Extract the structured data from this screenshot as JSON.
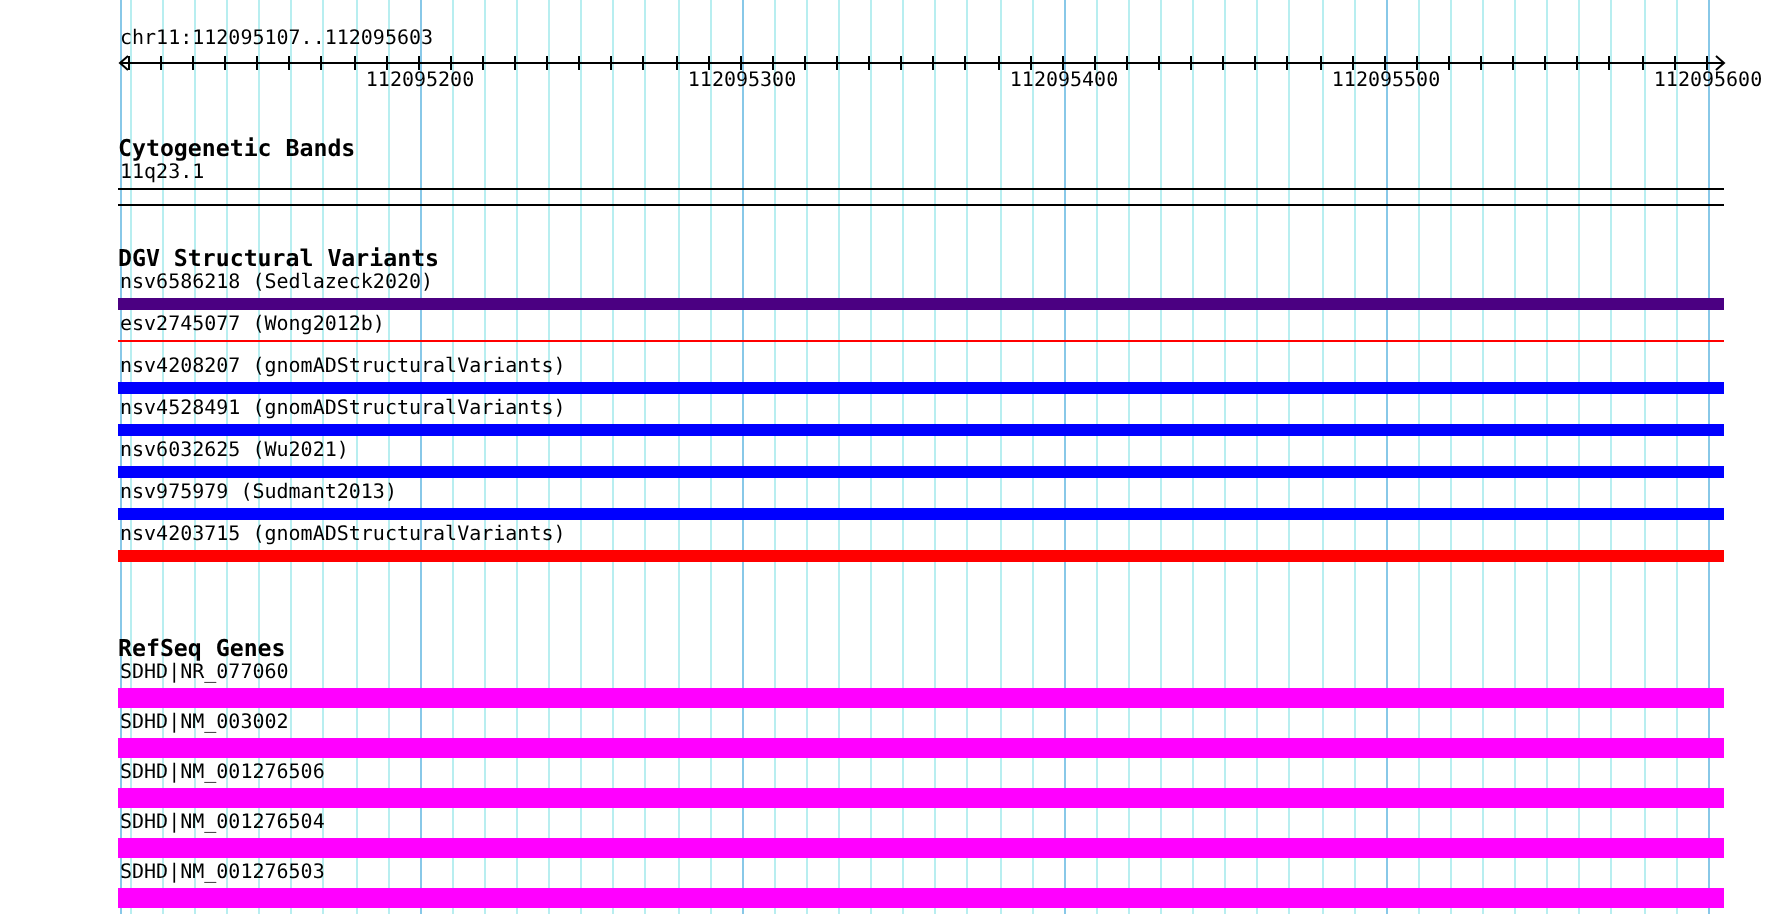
{
  "ruler": {
    "location": "chr11:112095107..112095603",
    "tick_labels": [
      "112095200",
      "112095300",
      "112095400",
      "112095500",
      "112095600"
    ]
  },
  "tracks": [
    {
      "title": "Cytogenetic Bands",
      "items": [
        {
          "label": "11q23.1",
          "kind": "line",
          "color": "#000000"
        }
      ]
    },
    {
      "title": "DGV Structural Variants",
      "items": [
        {
          "label": "nsv6586218 (Sedlazeck2020)",
          "kind": "bar",
          "color": "#4b0082"
        },
        {
          "label": "esv2745077 (Wong2012b)",
          "kind": "line",
          "color": "#ff0000"
        },
        {
          "label": "nsv4208207 (gnomADStructuralVariants)",
          "kind": "bar",
          "color": "#0000ff"
        },
        {
          "label": "nsv4528491 (gnomADStructuralVariants)",
          "kind": "bar",
          "color": "#0000ff"
        },
        {
          "label": "nsv6032625 (Wu2021)",
          "kind": "bar",
          "color": "#0000ff"
        },
        {
          "label": "nsv975979 (Sudmant2013)",
          "kind": "bar",
          "color": "#0000ff"
        },
        {
          "label": "nsv4203715 (gnomADStructuralVariants)",
          "kind": "bar",
          "color": "#ff0000"
        }
      ]
    },
    {
      "title": "RefSeq Genes",
      "items": [
        {
          "label": "SDHD|NR_077060",
          "kind": "gene",
          "color": "#ff00ff"
        },
        {
          "label": "SDHD|NM_003002",
          "kind": "gene",
          "color": "#ff00ff"
        },
        {
          "label": "SDHD|NM_001276506",
          "kind": "gene",
          "color": "#ff00ff"
        },
        {
          "label": "SDHD|NM_001276504",
          "kind": "gene",
          "color": "#ff00ff"
        },
        {
          "label": "SDHD|NM_001276503",
          "kind": "gene",
          "color": "#ff00ff"
        }
      ]
    }
  ]
}
